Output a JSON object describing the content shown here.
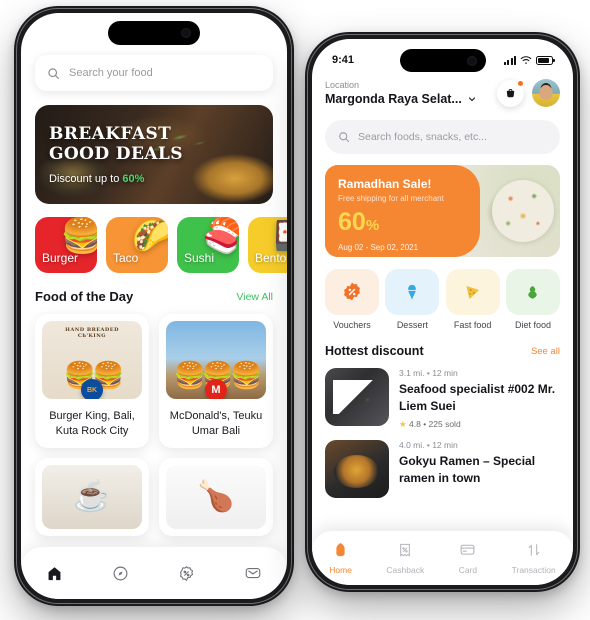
{
  "left_phone": {
    "search": {
      "placeholder": "Search your food",
      "icon": "search-icon"
    },
    "hero": {
      "title_line1": "BREAKFAST",
      "title_line2": "GOOD DEALS",
      "subtitle_prefix": "Discount up to ",
      "subtitle_accent": "60%",
      "accent_color": "#49d66a"
    },
    "categories": [
      {
        "label": "Burger",
        "emoji": "🍔",
        "color": "#e5252a"
      },
      {
        "label": "Taco",
        "emoji": "🌮",
        "color": "#f79435"
      },
      {
        "label": "Sushi",
        "emoji": "🍣",
        "color": "#3fc24b"
      },
      {
        "label": "Bento",
        "emoji": "🍱",
        "color": "#f5cc2a"
      }
    ],
    "section": {
      "title": "Food of the Day",
      "action": "View All",
      "action_color": "#3fbf63"
    },
    "food_cards": [
      {
        "name": "Burger King, Bali, Kuta Rock City",
        "brand_mark": "BK",
        "header": "Ch'KING",
        "header_small": "HAND BREADED"
      },
      {
        "name": "McDonald's, Teuku Umar Bali",
        "brand_mark": "M"
      }
    ],
    "food_cards_row2": [
      {
        "emoji": "☕",
        "brand": "starbucks"
      },
      {
        "emoji": "🍗",
        "brand": "kfc"
      }
    ],
    "tabbar": [
      {
        "name": "home",
        "icon": "🏠",
        "active": true
      },
      {
        "name": "explore",
        "icon": "◎",
        "active": false
      },
      {
        "name": "deals",
        "icon": "⊕",
        "active": false
      },
      {
        "name": "inbox",
        "icon": "✉",
        "active": false
      }
    ]
  },
  "right_phone": {
    "status_bar": {
      "time": "9:41",
      "signal": "signal-icon",
      "wifi": "wifi-icon",
      "battery": "battery-icon"
    },
    "header": {
      "location_label": "Location",
      "location_value": "Margonda Raya Selat...",
      "chevron": "⌄",
      "cart_icon": "cart-icon",
      "avatar": "user-avatar"
    },
    "search": {
      "placeholder": "Search foods, snacks, etc...",
      "icon": "search-icon"
    },
    "promo": {
      "title": "Ramadhan Sale!",
      "subtitle": "Free shipping for all merchant",
      "discount": "60",
      "discount_unit": "%",
      "dates": "Aug 02 - Sep 02, 2021",
      "bg_color": "#f58632",
      "discount_color": "#ffd84d"
    },
    "quick_actions": [
      {
        "label": "Vouchers",
        "icon": "🏷",
        "tile_bg": "#fdeee2",
        "glyph": "%",
        "glyph_color": "#f2722b"
      },
      {
        "label": "Dessert",
        "icon": "🍦",
        "tile_bg": "#e4f3fb",
        "glyph": "🍦",
        "glyph_color": "#35a9e0"
      },
      {
        "label": "Fast food",
        "icon": "🍕",
        "tile_bg": "#fdf4dd",
        "glyph": "🍕",
        "glyph_color": "#f0c13b"
      },
      {
        "label": "Diet food",
        "icon": "🌿",
        "tile_bg": "#e9f5e6",
        "glyph": "🌿",
        "glyph_color": "#4aa63c"
      }
    ],
    "section": {
      "title": "Hottest discount",
      "action": "See all",
      "action_color": "#f58632"
    },
    "items": [
      {
        "distance": "3.1 mi. • 12 min",
        "name": "Seafood specialist #002 Mr. Liem Suei",
        "rating": "4.8",
        "sold": "225 sold",
        "star": "★"
      },
      {
        "distance": "4.0 mi. • 12 min",
        "name": "Gokyu Ramen – Special ramen in town",
        "rating": "",
        "sold": "",
        "star": ""
      }
    ],
    "tabbar": [
      {
        "label": "Home",
        "icon": "⌂",
        "active": true
      },
      {
        "label": "Cashback",
        "icon": "⎙",
        "active": false
      },
      {
        "label": "Card",
        "icon": "▤",
        "active": false
      },
      {
        "label": "Transaction",
        "icon": "⇅",
        "active": false
      }
    ]
  }
}
